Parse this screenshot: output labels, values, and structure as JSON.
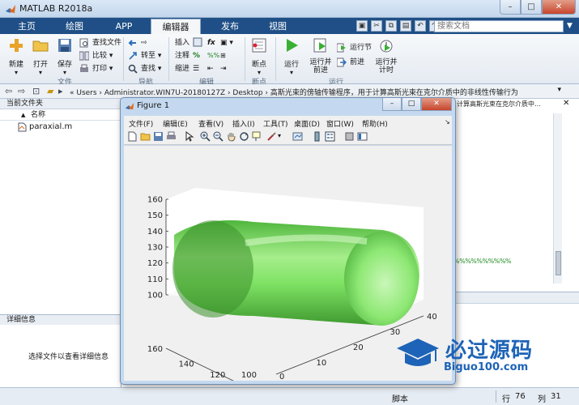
{
  "window": {
    "title": "MATLAB R2018a",
    "min": "–",
    "max": "□",
    "close": "✕"
  },
  "tabs": [
    "主页",
    "绘图",
    "APP",
    "编辑器",
    "发布",
    "视图"
  ],
  "search": {
    "placeholder": "搜索文档"
  },
  "ribbon": {
    "file": {
      "new": "新建",
      "open": "打开",
      "save": "保存",
      "find_files": "查找文件",
      "compare": "比较",
      "print": "打印",
      "group": "文件"
    },
    "navigate": {
      "goto": "转至",
      "find": "查找",
      "group": "导航"
    },
    "edit": {
      "insert": "插入",
      "comment": "注释",
      "indent": "缩进",
      "fx": "fx",
      "group": "编辑"
    },
    "breakpoints": {
      "label": "断点",
      "group": "断点"
    },
    "run": {
      "run": "运行",
      "run_advance": "运行并\n前进",
      "run_section": "运行节",
      "advance": "前进",
      "run_time": "运行并\n计时",
      "group": "运行"
    }
  },
  "address": {
    "path": "« Users › Administrator.WIN7U-20180127Z › Desktop › 高斯光束的傍轴传输程序，用于计算高斯光束在克尔介质中的非线性传输行为"
  },
  "current_folder": {
    "title": "当前文件夹",
    "col_name": "名称",
    "sort_arrow": "▲",
    "files": [
      "paraxial.m"
    ]
  },
  "details": {
    "title": "详细信息",
    "message": "选择文件以查看详细信息"
  },
  "editor": {
    "tab_title": "计算高斯光束在克尔介质中…",
    "green_code": "%%%%%%%%%%"
  },
  "status": {
    "mode": "脚本",
    "row_label": "行",
    "row": "76",
    "col_label": "列",
    "col": "31"
  },
  "figure": {
    "title": "Figure 1",
    "menu": [
      "文件(F)",
      "编辑(E)",
      "查看(V)",
      "插入(I)",
      "工具(T)",
      "桌面(D)",
      "窗口(W)",
      "帮助(H)"
    ],
    "controls": {
      "min": "–",
      "max": "□",
      "close": "✕"
    }
  },
  "chart_data": {
    "type": "surface",
    "description_visible": "3D green cylindrical surface plot",
    "z_ticks": [
      100,
      110,
      120,
      130,
      140,
      150,
      160
    ],
    "y_ticks": [
      100,
      120,
      140,
      160
    ],
    "x_ticks": [
      0,
      10,
      20,
      30,
      40
    ],
    "zlim": [
      100,
      160
    ],
    "ylim": [
      100,
      160
    ],
    "xlim": [
      0,
      40
    ],
    "color": "#5ecf4c"
  },
  "watermark": {
    "text": "必过源码",
    "sub": "Biguo100.com"
  }
}
